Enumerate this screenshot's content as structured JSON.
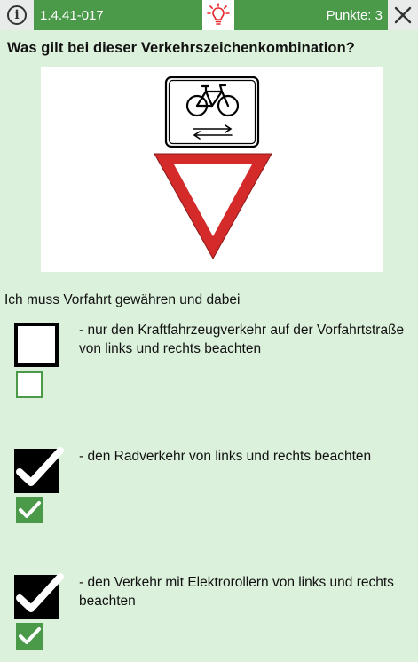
{
  "header": {
    "question_id": "1.4.41-017",
    "points_label": "Punkte: 3",
    "info_icon": "info-icon",
    "hint_icon": "lightbulb-icon",
    "close_icon": "close-icon"
  },
  "question": {
    "text": "Was gilt bei dieser Verkehrszeichenkombination?",
    "image": "sign-image",
    "intro": "Ich muss Vorfahrt gewähren und dabei"
  },
  "answers": [
    {
      "text": "- nur den Kraftfahrzeugverkehr auf der Vorfahrtstraße von links und rechts beachten",
      "selected": false,
      "correct": false
    },
    {
      "text": "- den Radverkehr von links und rechts beachten",
      "selected": true,
      "correct": true
    },
    {
      "text": "- den Verkehr mit Elektrorollern von links und rechts beachten",
      "selected": true,
      "correct": true
    }
  ],
  "colors": {
    "background": "#dcf1dc",
    "header_green": "#4a9a4a",
    "sign_red": "#d42a2a",
    "hint_red": "#e5252a"
  }
}
